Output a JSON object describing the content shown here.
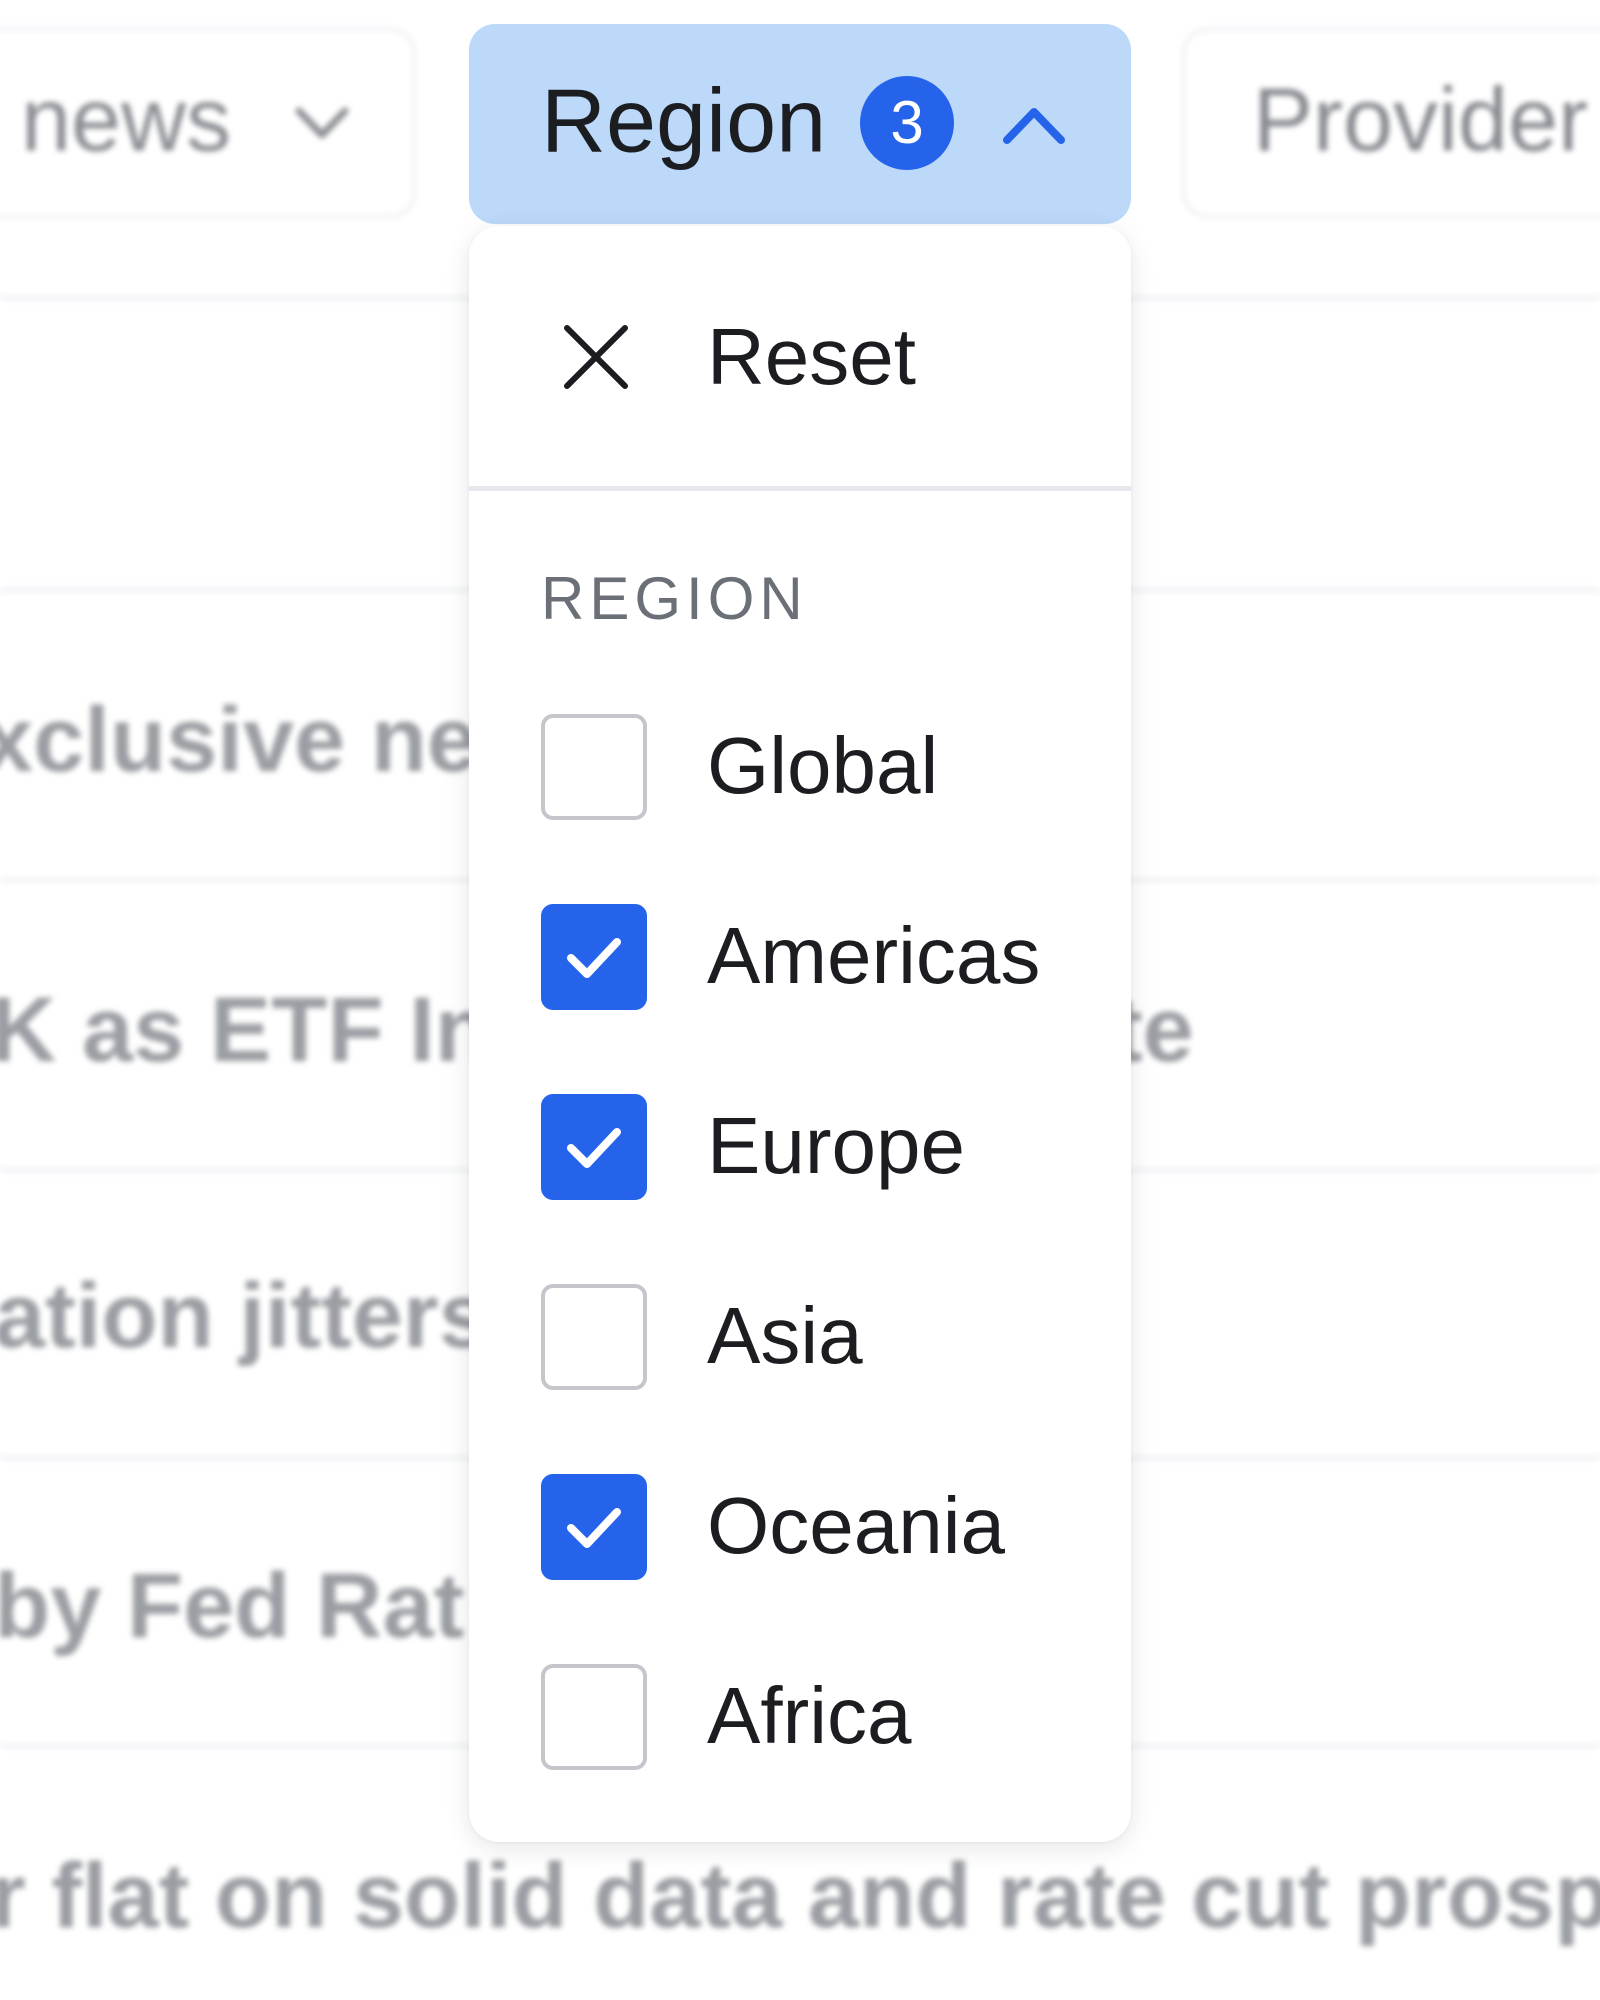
{
  "background": {
    "chips": {
      "left_label": "news",
      "right_label": "Provider"
    },
    "rows": [
      "xclusive nev",
      "K as ETF In",
      "te",
      "ation jitters",
      "by Fed Rat",
      "r flat on solid data and rate cut prosp"
    ]
  },
  "filter": {
    "label": "Region",
    "selected_count": "3",
    "expanded": true,
    "accent_color": "#2563eb",
    "button_bg": "#bcd9fa"
  },
  "dropdown": {
    "reset_label": "Reset",
    "reset_icon": "close-icon",
    "group_heading": "REGION",
    "options": [
      {
        "label": "Global",
        "checked": false
      },
      {
        "label": "Americas",
        "checked": true
      },
      {
        "label": "Europe",
        "checked": true
      },
      {
        "label": "Asia",
        "checked": false
      },
      {
        "label": "Oceania",
        "checked": true
      },
      {
        "label": "Africa",
        "checked": false
      }
    ]
  }
}
